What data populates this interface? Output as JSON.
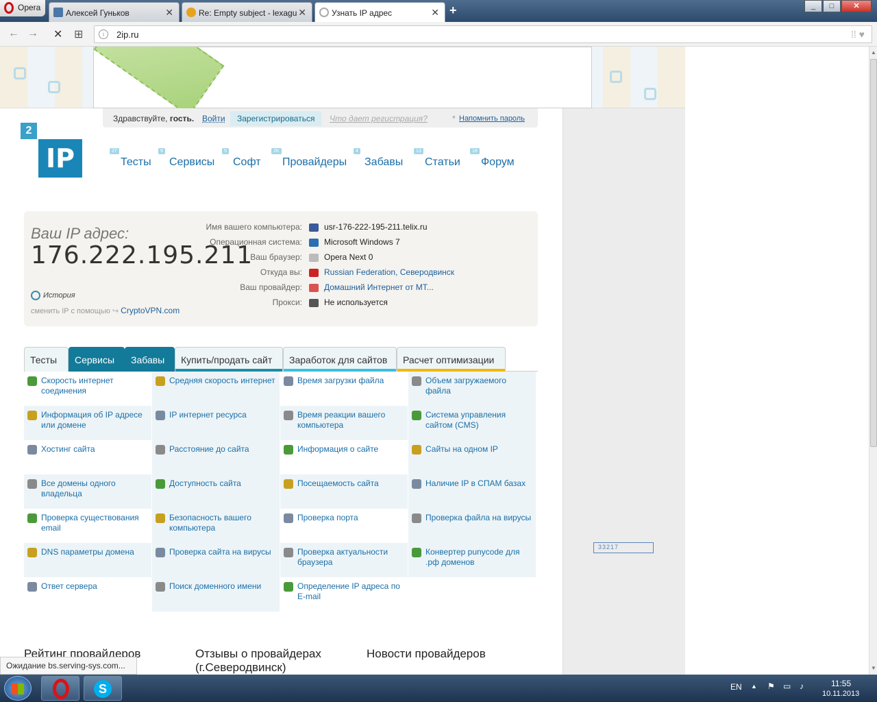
{
  "browser": {
    "menu_label": "Opera",
    "tabs": [
      {
        "title": "Алексей Гуньков",
        "icon": "vk-icon"
      },
      {
        "title": "Re: Empty subject - lexagu",
        "icon": "mail-icon"
      },
      {
        "title": "Узнать IP адрес",
        "icon": "loading-icon"
      }
    ],
    "url": "2ip.ru",
    "status": "Ожидание bs.serving-sys.com..."
  },
  "site": {
    "greeting": "Здравствуйте,",
    "guest": "гость.",
    "login": "Войти",
    "register": "Зарегистрироваться",
    "why_register": "Что дает регистрация?",
    "remind": "Напомнить пароль",
    "logo_small": "2",
    "logo_big": "IP",
    "nav": [
      {
        "label": "Тесты",
        "count": "27"
      },
      {
        "label": "Сервисы",
        "count": "9"
      },
      {
        "label": "Софт",
        "count": "5"
      },
      {
        "label": "Провайдеры",
        "count": "2K"
      },
      {
        "label": "Забавы",
        "count": "4"
      },
      {
        "label": "Статьи",
        "count": "13"
      },
      {
        "label": "Форум",
        "count": "18"
      }
    ],
    "counter": "33217"
  },
  "ipinfo": {
    "label": "Ваш IP адрес:",
    "ip": "176.222.195.211",
    "history": "История",
    "vpn_text": "сменить IP с помощью",
    "vpn_link": "CryptoVPN.com",
    "rows": [
      {
        "key": "Имя вашего компьютера:",
        "value": "usr-176-222-195-211.telix.ru",
        "link": false,
        "color": "#3a5a9a"
      },
      {
        "key": "Операционная система:",
        "value": "Microsoft Windows 7",
        "link": false,
        "color": "#2a6fb0"
      },
      {
        "key": "Ваш браузер:",
        "value": "Opera Next 0",
        "link": false,
        "color": "#bbbbbb"
      },
      {
        "key": "Откуда вы:",
        "value": "Russian Federation, Северодвинск",
        "link": true,
        "color": "#cc2222"
      },
      {
        "key": "Ваш провайдер:",
        "value": "Домашний Интернет от МТ...",
        "link": true,
        "color": "#d9534f"
      },
      {
        "key": "Прокси:",
        "value": "Не используется",
        "link": false,
        "color": "#555555"
      }
    ]
  },
  "service_tabs": [
    {
      "label": "Тесты",
      "active": false,
      "stripe": ""
    },
    {
      "label": "Сервисы",
      "active": true,
      "stripe": "#0e6a86"
    },
    {
      "label": "Забавы",
      "active": true,
      "stripe": "#0e6a86"
    },
    {
      "label": "Купить/продать сайт",
      "active": false,
      "stripe": "#1a8fa8"
    },
    {
      "label": "Заработок для сайтов",
      "active": false,
      "stripe": "#39c0e0"
    },
    {
      "label": "Расчет оптимизации",
      "active": false,
      "stripe": "#f2b800"
    }
  ],
  "services": [
    [
      "Скорость интернет соединения",
      "Средняя скорость интернет",
      "Время загрузки файла",
      "Объем загружаемого файла"
    ],
    [
      "Информация об IP адресе или домене",
      "IP интернет ресурса",
      "Время реакции вашего компьютера",
      "Система управления сайтом (CMS)"
    ],
    [
      "Хостинг сайта",
      "Расстояние до сайта",
      "Информация о сайте",
      "Сайты на одном IP"
    ],
    [
      "Все домены одного владельца",
      "Доступность сайта",
      "Посещаемость сайта",
      "Наличие IP в СПАМ базах"
    ],
    [
      "Проверка существования email",
      "Безопасность вашего компьютера",
      "Проверка порта",
      "Проверка файла на вирусы"
    ],
    [
      "DNS параметры домена",
      "Проверка сайта на вирусы",
      "Проверка актуальности браузера",
      "Конвертер punycode для .рф доменов"
    ],
    [
      "Ответ сервера",
      "Поиск доменного имени",
      "Определение IP адреса по E-mail",
      ""
    ]
  ],
  "service_icon_colors": [
    "#4a9a3a",
    "#c8a020",
    "#7a8aa0",
    "#8a8a8a"
  ],
  "bottom_headings": [
    "Рейтинг провайдеров",
    "Отзывы о провайдерах (г.Северодвинск)",
    "Новости провайдеров"
  ],
  "taskbar": {
    "lang": "EN",
    "time": "11:55",
    "date": "10.11.2013"
  }
}
